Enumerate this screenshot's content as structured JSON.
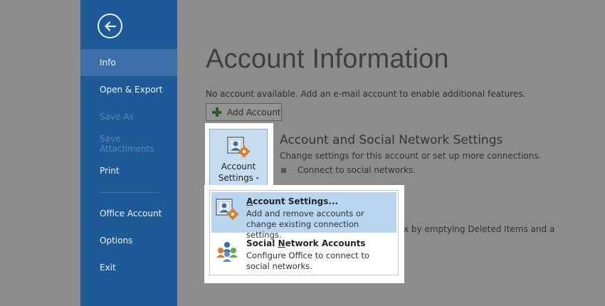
{
  "sidebar": {
    "items": [
      {
        "label": "Info",
        "selected": true
      },
      {
        "label": "Open & Export"
      },
      {
        "label": "Save As",
        "disabled": true
      },
      {
        "label": "Save Attachments",
        "disabled": true
      },
      {
        "label": "Print"
      },
      {
        "label": "Office Account"
      },
      {
        "label": "Options"
      },
      {
        "label": "Exit"
      }
    ]
  },
  "main": {
    "title": "Account Information",
    "no_account_text": "No account available. Add an e-mail account to enable additional features.",
    "add_account_label": "Add Account",
    "account_settings_tile": {
      "line1": "Account",
      "line2": "Settings",
      "caret": "▾"
    },
    "section": {
      "heading": "Account and Social Network Settings",
      "description": "Change settings for this account or set up more connections.",
      "bullet": "Connect to social networks."
    },
    "partial_text": "x by emptying Deleted Items and a"
  },
  "dropdown": {
    "items": [
      {
        "title_prefix": "",
        "title_underline": "A",
        "title_rest": "ccount Settings...",
        "desc1": "Add and remove accounts or",
        "desc2": "change existing connection settings."
      },
      {
        "title_prefix": "Social ",
        "title_underline": "N",
        "title_rest": "etwork Accounts",
        "desc1": "Configure Office to connect to",
        "desc2": "social networks."
      }
    ]
  },
  "colors": {
    "sidebar": "#1f5a98",
    "sidebar_selected": "#3a6fa8",
    "backdrop": "#8c8c8c",
    "highlight": "#b8d6ef"
  }
}
